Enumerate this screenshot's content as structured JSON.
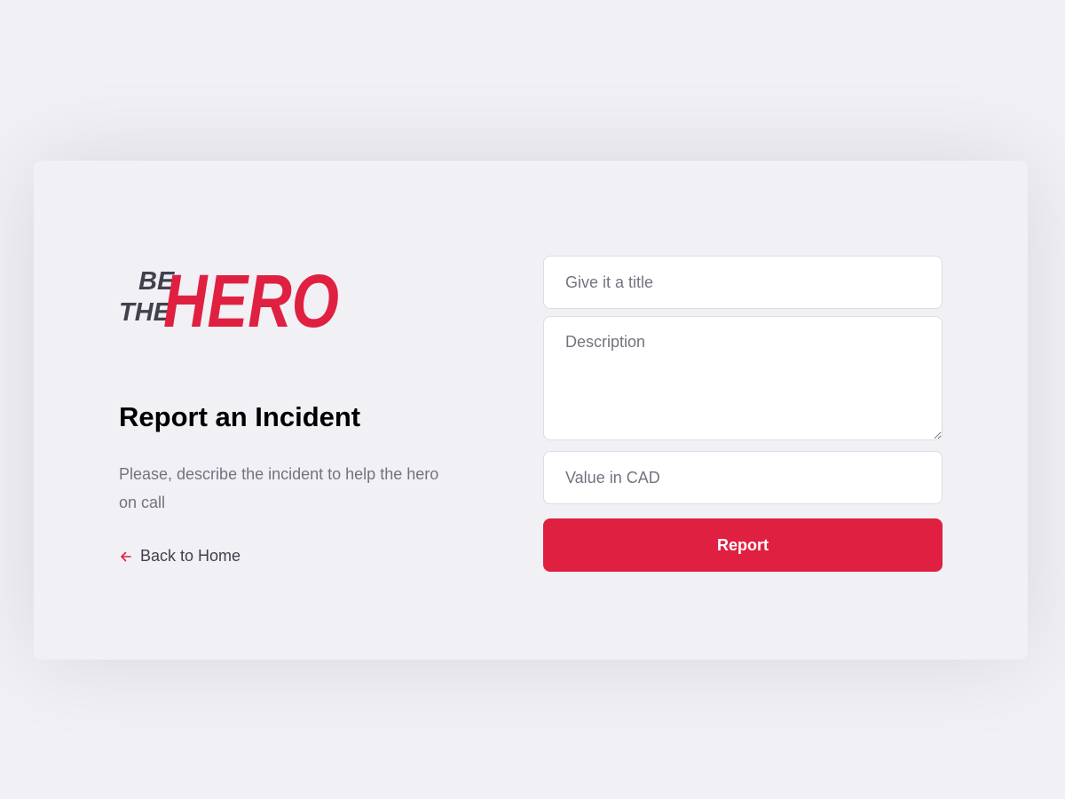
{
  "logo": {
    "line1": "BE",
    "line2": "THE",
    "line3": "HERO",
    "dark_color": "#41414d",
    "brand_color": "#e02041"
  },
  "heading": "Report an Incident",
  "description": "Please, describe the incident to help the hero on call",
  "back_link": {
    "icon": "arrow-left-icon",
    "label": "Back to Home"
  },
  "form": {
    "title_placeholder": "Give it a title",
    "description_placeholder": "Description",
    "value_placeholder": "Value in CAD",
    "submit_label": "Report"
  }
}
